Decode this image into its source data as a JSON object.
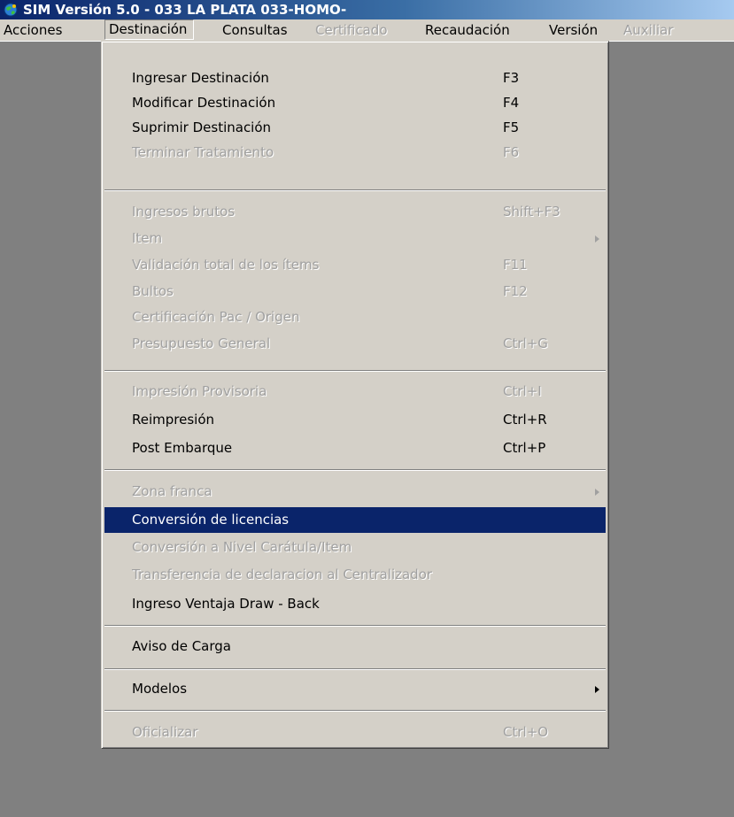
{
  "window": {
    "title": "SIM Versión 5.0 - 033 LA PLATA 033-HOMO-",
    "icon": "globe-app-icon"
  },
  "menubar": {
    "items": [
      {
        "label": "Acciones",
        "enabled": true
      },
      {
        "label": "Destinación",
        "enabled": true,
        "open": true
      },
      {
        "label": "Consultas",
        "enabled": true
      },
      {
        "label": "Certificado",
        "enabled": false
      },
      {
        "label": "Recaudación",
        "enabled": true
      },
      {
        "label": "Versión",
        "enabled": true
      },
      {
        "label": "Auxiliar",
        "enabled": false
      }
    ]
  },
  "menu": {
    "items": [
      {
        "label": "Ingresar Destinación",
        "shortcut": "F3",
        "enabled": true
      },
      {
        "label": "Modificar Destinación",
        "shortcut": "F4",
        "enabled": true
      },
      {
        "label": "Suprimir Destinación",
        "shortcut": "F5",
        "enabled": true
      },
      {
        "label": "Terminar Tratamiento",
        "shortcut": "F6",
        "enabled": false
      },
      {
        "label": "Ingresos brutos",
        "shortcut": "Shift+F3",
        "enabled": false
      },
      {
        "label": "Item",
        "shortcut": "",
        "enabled": false,
        "submenu": true
      },
      {
        "label": "Validación total de los ítems",
        "shortcut": "F11",
        "enabled": false
      },
      {
        "label": "Bultos",
        "shortcut": "F12",
        "enabled": false
      },
      {
        "label": "Certificación Pac / Origen",
        "shortcut": "",
        "enabled": false
      },
      {
        "label": "Presupuesto General",
        "shortcut": "Ctrl+G",
        "enabled": false
      },
      {
        "label": "Impresión Provisoria",
        "shortcut": "Ctrl+I",
        "enabled": false
      },
      {
        "label": "Reimpresión",
        "shortcut": "Ctrl+R",
        "enabled": true
      },
      {
        "label": "Post Embarque",
        "shortcut": "Ctrl+P",
        "enabled": true
      },
      {
        "label": "Zona franca",
        "shortcut": "",
        "enabled": false,
        "submenu": true
      },
      {
        "label": "Conversión de licencias",
        "shortcut": "",
        "enabled": true,
        "selected": true
      },
      {
        "label": "Conversión a Nivel Carátula/Item",
        "shortcut": "",
        "enabled": false
      },
      {
        "label": "Transferencia de declaracion al Centralizador",
        "shortcut": "",
        "enabled": false
      },
      {
        "label": "Ingreso Ventaja Draw - Back",
        "shortcut": "",
        "enabled": true
      },
      {
        "label": "Aviso de Carga",
        "shortcut": "",
        "enabled": true
      },
      {
        "label": "Modelos",
        "shortcut": "",
        "enabled": true,
        "submenu": true
      },
      {
        "label": "Oficializar",
        "shortcut": "Ctrl+O",
        "enabled": false
      }
    ]
  },
  "colors": {
    "titlebar_start": "#0a246a",
    "titlebar_end": "#a6caf0",
    "menu_face": "#d4d0c8",
    "selection": "#0a246a",
    "workspace": "#808080",
    "disabled_text": "#a0a0a0"
  }
}
